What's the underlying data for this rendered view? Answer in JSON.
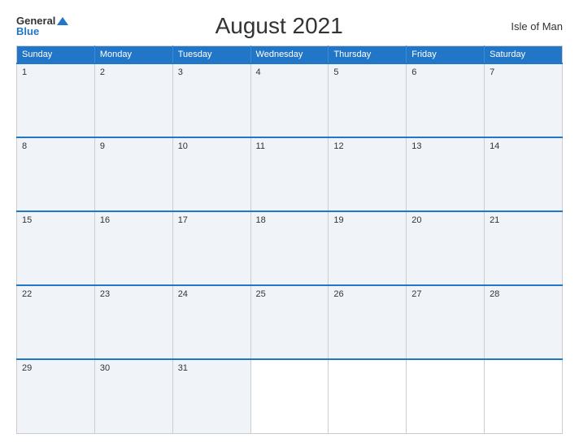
{
  "header": {
    "logo_general": "General",
    "logo_blue": "Blue",
    "title": "August 2021",
    "region": "Isle of Man"
  },
  "calendar": {
    "days_of_week": [
      "Sunday",
      "Monday",
      "Tuesday",
      "Wednesday",
      "Thursday",
      "Friday",
      "Saturday"
    ],
    "weeks": [
      [
        {
          "date": "1",
          "empty": false
        },
        {
          "date": "2",
          "empty": false
        },
        {
          "date": "3",
          "empty": false
        },
        {
          "date": "4",
          "empty": false
        },
        {
          "date": "5",
          "empty": false
        },
        {
          "date": "6",
          "empty": false
        },
        {
          "date": "7",
          "empty": false
        }
      ],
      [
        {
          "date": "8",
          "empty": false
        },
        {
          "date": "9",
          "empty": false
        },
        {
          "date": "10",
          "empty": false
        },
        {
          "date": "11",
          "empty": false
        },
        {
          "date": "12",
          "empty": false
        },
        {
          "date": "13",
          "empty": false
        },
        {
          "date": "14",
          "empty": false
        }
      ],
      [
        {
          "date": "15",
          "empty": false
        },
        {
          "date": "16",
          "empty": false
        },
        {
          "date": "17",
          "empty": false
        },
        {
          "date": "18",
          "empty": false
        },
        {
          "date": "19",
          "empty": false
        },
        {
          "date": "20",
          "empty": false
        },
        {
          "date": "21",
          "empty": false
        }
      ],
      [
        {
          "date": "22",
          "empty": false
        },
        {
          "date": "23",
          "empty": false
        },
        {
          "date": "24",
          "empty": false
        },
        {
          "date": "25",
          "empty": false
        },
        {
          "date": "26",
          "empty": false
        },
        {
          "date": "27",
          "empty": false
        },
        {
          "date": "28",
          "empty": false
        }
      ],
      [
        {
          "date": "29",
          "empty": false
        },
        {
          "date": "30",
          "empty": false
        },
        {
          "date": "31",
          "empty": false
        },
        {
          "date": "",
          "empty": true
        },
        {
          "date": "",
          "empty": true
        },
        {
          "date": "",
          "empty": true
        },
        {
          "date": "",
          "empty": true
        }
      ]
    ]
  }
}
